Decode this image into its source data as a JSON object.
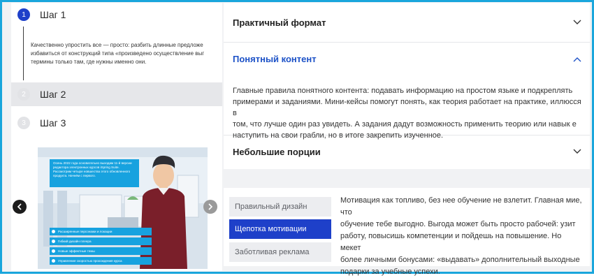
{
  "steps": {
    "items": [
      {
        "num": "1",
        "label": "Шаг 1"
      },
      {
        "num": "2",
        "label": "Шаг 2"
      },
      {
        "num": "3",
        "label": "Шаг 3"
      }
    ],
    "body_lines": [
      "Качественно упростить все — просто: разбить длинные предложе",
      "избавиться от конструкций типа «произведено осуществление выг",
      "термины только там, где нужны именно они."
    ]
  },
  "slide": {
    "callout": "Осень 2022 года основательно выходим 11-й версии редактора электронных курсов iSpring Suite. Рассмотрим четыре новшества этого обновленного продукта. Начнём с первого.",
    "bullets": [
      "Расширенные персонажи и локации",
      "Гибкий дизайн плеера",
      "Новые эффектные темы",
      "Управление скоростью прохождения курса"
    ],
    "prev_icon": "chevron-left-icon",
    "next_icon": "chevron-right-icon"
  },
  "accordion": {
    "items": [
      {
        "title": "Практичный формат",
        "icon": "chevron-down-icon"
      },
      {
        "title": "Понятный контент",
        "icon": "chevron-up-icon"
      },
      {
        "title": "Небольшие порции",
        "icon": "chevron-down-icon"
      }
    ],
    "open_body": [
      "Главные правила понятного контента: подавать информацию на простом языке и подкреплять",
      "примерами и заданиями. Мини-кейсы помогут понять, как теория работает на практике, иллюсся в",
      "том, что лучше один раз увидеть. А задания дадут возможность применить теорию или навык е",
      "наступить на свои грабли, но в итоге закрепить изученное."
    ]
  },
  "tabs": {
    "items": [
      {
        "label": "Правильный дизайн"
      },
      {
        "label": "Щепотка мотивации"
      },
      {
        "label": "Заботливая реклама"
      }
    ],
    "content_lines": [
      "Мотивация как топливо, без нее обучение не взлетит. Главная мие, что",
      "обучение тебе выгодно. Выгода может быть просто рабочей: узит",
      "работу, повысишь компетенции и пойдешь на повышение. Но мекет",
      "более личными бонусами: «выдавать» дополнительный выходные",
      "подарки за учебные успехи."
    ]
  },
  "colors": {
    "accent": "#1e40c9",
    "frame": "#1aa6dc",
    "open_title": "#1d52c7",
    "slide_blue": "#17a2df"
  }
}
